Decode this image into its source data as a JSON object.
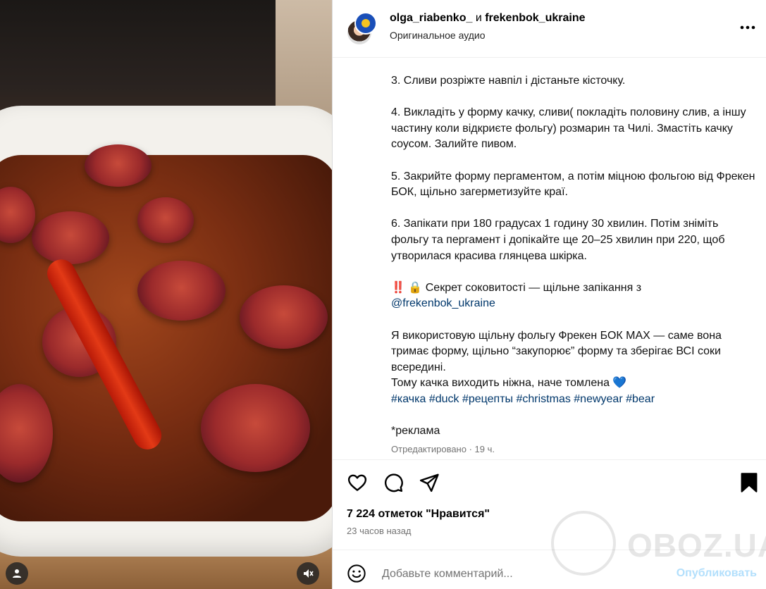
{
  "header": {
    "user1": "olga_riabenko_",
    "conjunction": " и ",
    "user2": "frekenbok_ukraine",
    "audio": "Оригинальное аудио",
    "more": "•••"
  },
  "caption": {
    "step3": "3. Сливи розріжте навпіл і дістаньте кісточку.",
    "step4": "4. Викладіть у форму качку, сливи( покладіть половину слив, а іншу частину коли відкриєте фольгу) розмарин та Чилі. Змастіть качку соусом. Залийте пивом.",
    "step5": "5. Закрийте форму пергаментом, а потім міцною фольгою від Фрекен БОК, щільно загерметизуйте краї.",
    "step6": "6. Запікати при 180 градусах 1 годину 30 хвилин. Потім зніміть фольгу та пергамент і допікайте ще 20–25 хвилин при 220, щоб утворилася красива глянцева шкірка.",
    "secret": "‼️ 🔒 Секрет соковитості — щільне запікання з",
    "mention": "@frekenbok_ukraine",
    "foil": "Я використовую щільну фольгу Фрекен БОК MAX — саме вона тримає форму, щільно “закупорює” форму та зберігає ВСІ соки всередині.",
    "tender": "Тому качка виходить ніжна, наче томлена 💙",
    "hashtags": "#качка #duck #рецепты #christmas #newyear #bear",
    "ad": "*реклама",
    "edited": "Отредактировано · 19 ч."
  },
  "engagement": {
    "likes": "7 224 отметок \"Нравится\"",
    "time_ago": "23 часов назад"
  },
  "comment": {
    "placeholder": "Добавьте комментарий...",
    "publish": "Опубликовать"
  },
  "watermark": {
    "text": "OBOZ.UA"
  },
  "icons": {
    "like": "heart-icon",
    "comment": "comment-icon",
    "share": "share-icon",
    "save": "bookmark-icon",
    "emoji": "emoji-icon",
    "tagged_users": "user-icon",
    "mute": "muted-speaker-icon"
  }
}
